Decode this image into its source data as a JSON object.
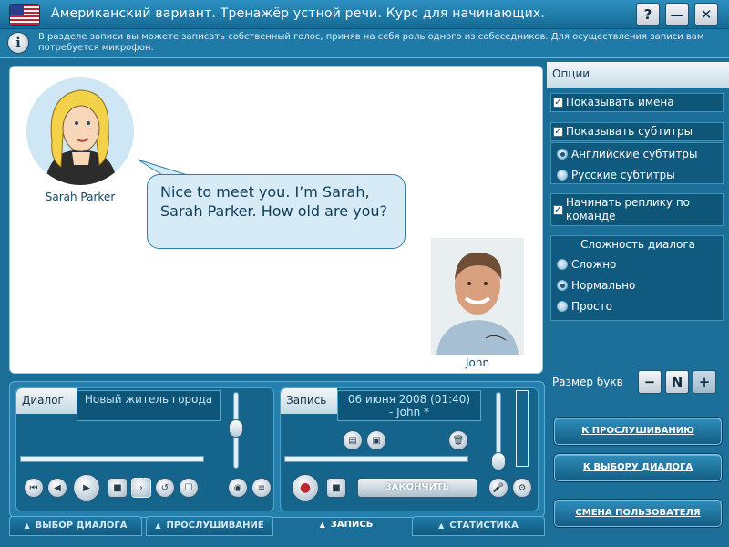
{
  "window": {
    "title": "Американский вариант. Тренажёр устной речи. Курс для начинающих.",
    "help_label": "?",
    "minimize_label": "—",
    "close_label": "✕"
  },
  "info": {
    "icon_letter": "i",
    "text": "В разделе записи вы можете записать собственный голос, приняв на себя роль одного из собеседников. Для осуществления записи вам потребуется микрофон."
  },
  "stage": {
    "speaker1_name": "Sarah Parker",
    "speaker2_name": "John",
    "bubble_text": "Nice to meet you. I’m Sarah, Sarah Parker. How old are you?"
  },
  "options": {
    "header": "Опции",
    "show_names": {
      "label": "Показывать имена",
      "checked": true
    },
    "show_subtitles": {
      "label": "Показывать субтитры",
      "checked": true
    },
    "subtitle_langs": [
      {
        "label": "Английские субтитры",
        "selected": true
      },
      {
        "label": "Русские субтитры",
        "selected": false
      }
    ],
    "start_on_command": {
      "label": "Начинать реплику по команде",
      "checked": true
    },
    "complexity": {
      "title": "Сложность диалога",
      "levels": [
        {
          "label": "Сложно",
          "selected": false
        },
        {
          "label": "Нормально",
          "selected": true
        },
        {
          "label": "Просто",
          "selected": false
        }
      ]
    },
    "font_size": {
      "label": "Размер букв",
      "minus": "−",
      "normal": "N",
      "plus": "+"
    },
    "buttons": {
      "to_listening": "К ПРОСЛУШИВАНИЮ",
      "to_dialog_select": "К ВЫБОРУ ДИАЛОГА",
      "change_user": "СМЕНА ПОЛЬЗОВАТЕЛЯ"
    }
  },
  "player": {
    "dialog_label": "Диалог",
    "dialog_value": "Новый житель города",
    "record_label": "Запись",
    "record_value": "06 июня 2008 (01:40)\n- John *",
    "finish_label": "ЗАКОНЧИТЬ"
  },
  "tabs": [
    {
      "label": "ВЫБОР ДИАЛОГА",
      "active": false
    },
    {
      "label": "ПРОСЛУШИВАНИЕ",
      "active": false
    },
    {
      "label": "ЗАПИСЬ",
      "active": true
    },
    {
      "label": "СТАТИСТИКА",
      "active": false
    }
  ]
}
